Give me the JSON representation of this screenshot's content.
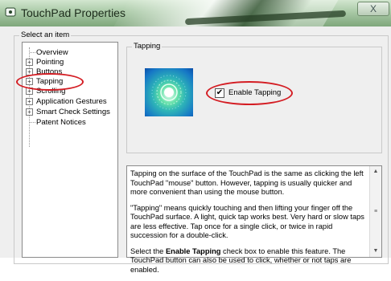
{
  "window": {
    "title": "TouchPad Properties",
    "close_glyph": "X"
  },
  "select_group": {
    "label": "Select an item"
  },
  "tree": {
    "items": [
      {
        "label": "Overview",
        "expander": ""
      },
      {
        "label": "Pointing",
        "expander": "+"
      },
      {
        "label": "Buttons",
        "expander": "+"
      },
      {
        "label": "Tapping",
        "expander": "+"
      },
      {
        "label": "Scrolling",
        "expander": "+"
      },
      {
        "label": "Application Gestures",
        "expander": "+"
      },
      {
        "label": "Smart Check Settings",
        "expander": "+"
      },
      {
        "label": "Patent Notices",
        "expander": ""
      }
    ]
  },
  "tapping_group": {
    "label": "Tapping"
  },
  "enable_tapping": {
    "label": "Enable Tapping",
    "check": "✔"
  },
  "info": {
    "p1": "Tapping on the surface of the TouchPad is the same as clicking the left TouchPad \"mouse\" button. However, tapping is usually quicker and more convenient than using the mouse button.",
    "p2": "\"Tapping\" means quickly touching and then lifting your finger off the TouchPad surface. A light, quick tap works best. Very hard or slow taps are less effective. Tap once for a single click, or twice in rapid succession for a double-click.",
    "p3_prefix": "Select the ",
    "p3_bold": "Enable Tapping",
    "p3_suffix": " check box to enable this feature. The",
    "p3_cut": "TouchPad button can also be used to click, whether or not taps are enabled."
  },
  "scrollbar": {
    "up": "▲",
    "down": "▼",
    "mid": "≡"
  },
  "colors": {
    "highlight": "#d41d23",
    "titlebar": "#a9c9a6"
  }
}
